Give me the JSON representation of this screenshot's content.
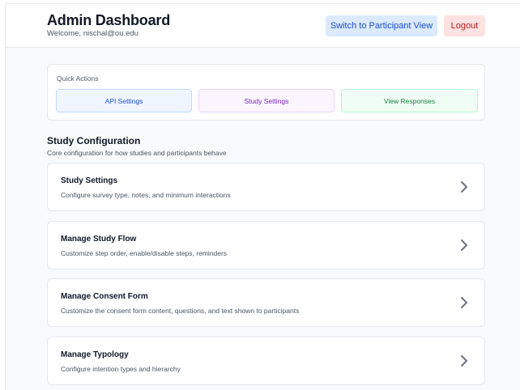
{
  "header": {
    "title": "Admin Dashboard",
    "welcome": "Welcome, nischal@ou.edu",
    "switch_label": "Switch to Participant View",
    "logout_label": "Logout"
  },
  "quick_actions": {
    "title": "Quick Actions",
    "buttons": [
      {
        "label": "API Settings"
      },
      {
        "label": "Study Settings"
      },
      {
        "label": "View Responses"
      }
    ]
  },
  "study_config": {
    "title": "Study Configuration",
    "subtitle": "Core configuration for how studies and participants behave",
    "cards": [
      {
        "title": "Study Settings",
        "description": "Configure survey type, notes, and minimum interactions",
        "icon": "chevron-right-icon"
      },
      {
        "title": "Manage Study Flow",
        "description": "Customize step order, enable/disable steps, reminders",
        "icon": "chevron-right-icon"
      },
      {
        "title": "Manage Consent Form",
        "description": "Customize the consent form content, questions, and text shown to participants",
        "icon": "chevron-right-icon"
      },
      {
        "title": "Manage Typology",
        "description": "Configure intention types and hierarchy",
        "icon": "chevron-right-icon"
      }
    ]
  },
  "colors": {
    "switch_bg": "#dbeafe",
    "switch_text": "#1d4ed8",
    "logout_bg": "#fde2e2",
    "logout_text": "#b91c1c",
    "api_accent": "#1d4ed8",
    "study_accent": "#7e22ce",
    "responses_accent": "#15803d"
  }
}
